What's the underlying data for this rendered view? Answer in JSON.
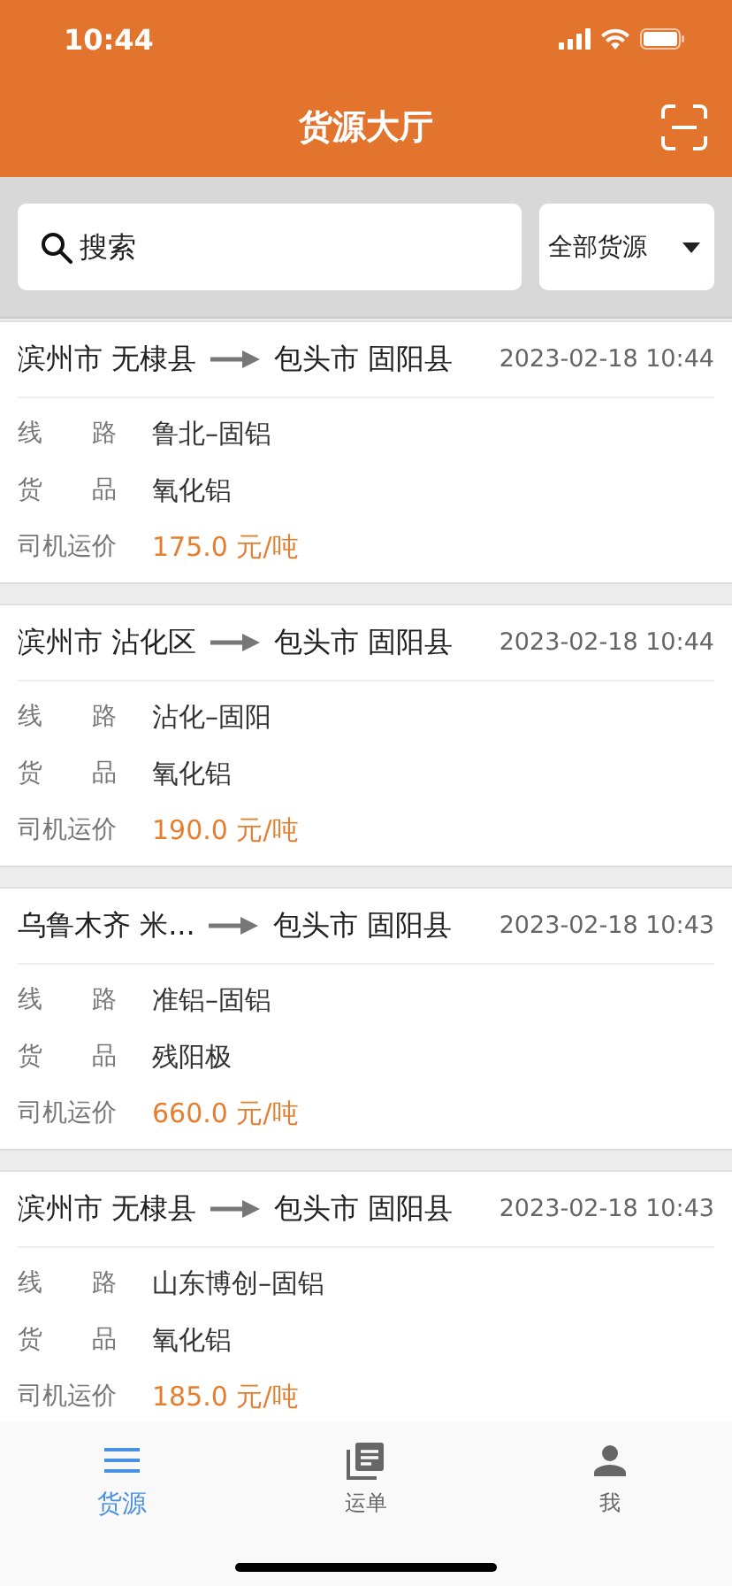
{
  "status_bar": {
    "time": "10:44"
  },
  "header": {
    "title": "货源大厅"
  },
  "search": {
    "placeholder": "搜索"
  },
  "filter": {
    "label": "全部货源"
  },
  "cargo_list": [
    {
      "origin": "滨州市 无棣县",
      "destination": "包头市 固阳县",
      "time": "2023-02-18 10:44",
      "route_label": "线　　路",
      "route": "鲁北–固铝",
      "goods_label": "货　　品",
      "goods": "氧化铝",
      "price_label": "司机运价",
      "price": "175.0 元/吨"
    },
    {
      "origin": "滨州市 沾化区",
      "destination": "包头市 固阳县",
      "time": "2023-02-18 10:44",
      "route_label": "线　　路",
      "route": "沾化–固阳",
      "goods_label": "货　　品",
      "goods": "氧化铝",
      "price_label": "司机运价",
      "price": "190.0 元/吨"
    },
    {
      "origin": "乌鲁木齐 米...",
      "destination": "包头市 固阳县",
      "time": "2023-02-18 10:43",
      "route_label": "线　　路",
      "route": "准铝–固铝",
      "goods_label": "货　　品",
      "goods": "残阳极",
      "price_label": "司机运价",
      "price": "660.0 元/吨"
    },
    {
      "origin": "滨州市 无棣县",
      "destination": "包头市 固阳县",
      "time": "2023-02-18 10:43",
      "route_label": "线　　路",
      "route": "山东博创–固铝",
      "goods_label": "货　　品",
      "goods": "氧化铝",
      "price_label": "司机运价",
      "price": "185.0 元/吨"
    }
  ],
  "tab_bar": [
    {
      "label": "货源",
      "kind": "list",
      "selected": true
    },
    {
      "label": "运单",
      "kind": "orders",
      "selected": false
    },
    {
      "label": "我",
      "kind": "person",
      "selected": false
    }
  ]
}
